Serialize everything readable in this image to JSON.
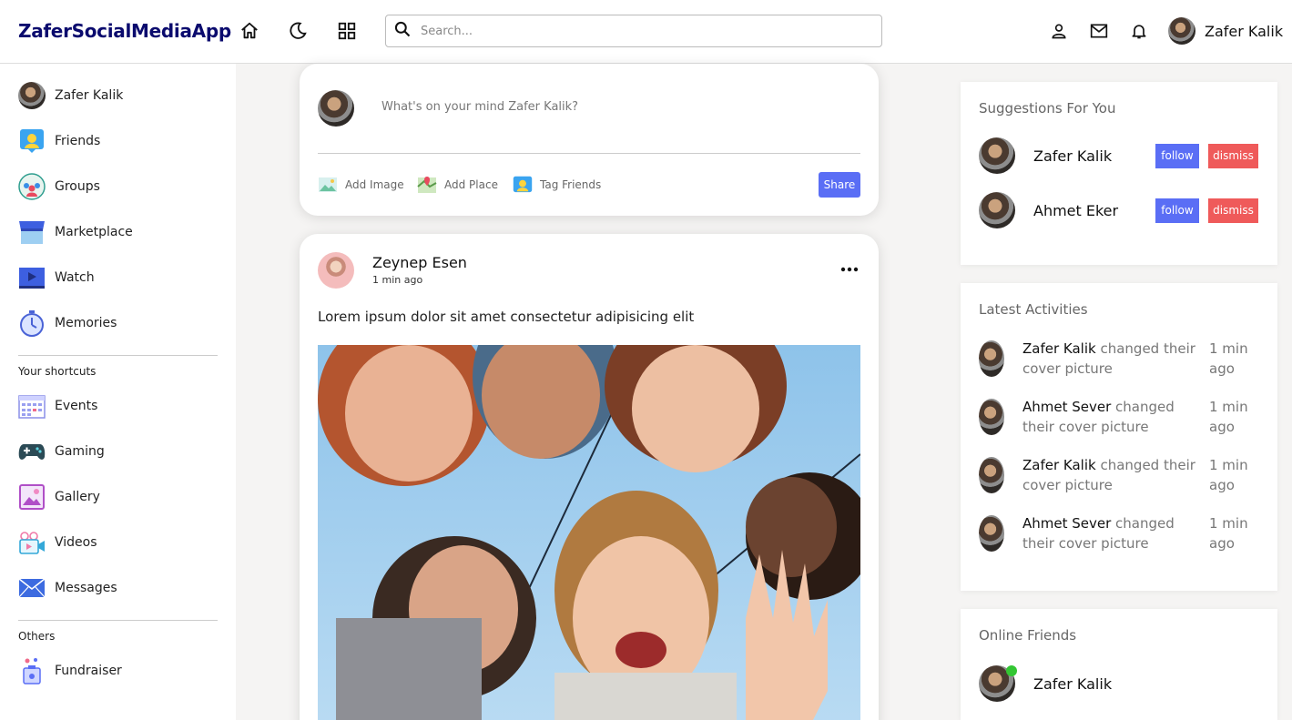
{
  "navbar": {
    "logo": "ZaferSocialMediaApp",
    "search_placeholder": "Search...",
    "user_name": "Zafer Kalik",
    "icons": [
      "home-icon",
      "dark-mode-icon",
      "apps-grid-icon",
      "search-icon",
      "person-icon",
      "mail-icon",
      "notifications-icon"
    ]
  },
  "left_sidebar": {
    "user_name": "Zafer Kalik",
    "menu": [
      {
        "label": "Friends",
        "icon": "friends-icon"
      },
      {
        "label": "Groups",
        "icon": "groups-icon"
      },
      {
        "label": "Marketplace",
        "icon": "marketplace-icon"
      },
      {
        "label": "Watch",
        "icon": "watch-icon"
      },
      {
        "label": "Memories",
        "icon": "memories-icon"
      }
    ],
    "shortcuts_title": "Your shortcuts",
    "shortcuts": [
      {
        "label": "Events",
        "icon": "events-icon"
      },
      {
        "label": "Gaming",
        "icon": "gaming-icon"
      },
      {
        "label": "Gallery",
        "icon": "gallery-icon"
      },
      {
        "label": "Videos",
        "icon": "videos-icon"
      },
      {
        "label": "Messages",
        "icon": "messages-icon"
      }
    ],
    "others_title": "Others",
    "others": [
      {
        "label": "Fundraiser",
        "icon": "fundraiser-icon"
      }
    ]
  },
  "share": {
    "prompt": "What's on your mind Zafer Kalik?",
    "add_image": "Add Image",
    "add_place": "Add Place",
    "tag_friends": "Tag Friends",
    "share_label": "Share"
  },
  "post": {
    "author": "Zeynep Esen",
    "time": "1 min ago",
    "text": "Lorem ipsum dolor sit amet consectetur adipisicing elit"
  },
  "suggestions": {
    "title": "Suggestions For You",
    "follow_label": "follow",
    "dismiss_label": "dismiss",
    "people": [
      {
        "name": "Zafer Kalik"
      },
      {
        "name": "Ahmet Eker"
      }
    ]
  },
  "activities": {
    "title": "Latest Activities",
    "items": [
      {
        "who": "Zafer Kalik",
        "what": " changed their cover picture",
        "time": "1 min ago"
      },
      {
        "who": "Ahmet Sever",
        "what": " changed their cover picture",
        "time": "1 min ago"
      },
      {
        "who": "Zafer Kalik",
        "what": " changed their cover picture",
        "time": "1 min ago"
      },
      {
        "who": "Ahmet Sever",
        "what": " changed their cover picture",
        "time": "1 min ago"
      }
    ]
  },
  "online": {
    "title": "Online Friends",
    "friends": [
      {
        "name": "Zafer Kalik"
      }
    ]
  },
  "colors": {
    "accent": "#5a6ef5",
    "danger": "#ef5a5a",
    "online": "#33c633",
    "logo": "#0b0b6e"
  }
}
